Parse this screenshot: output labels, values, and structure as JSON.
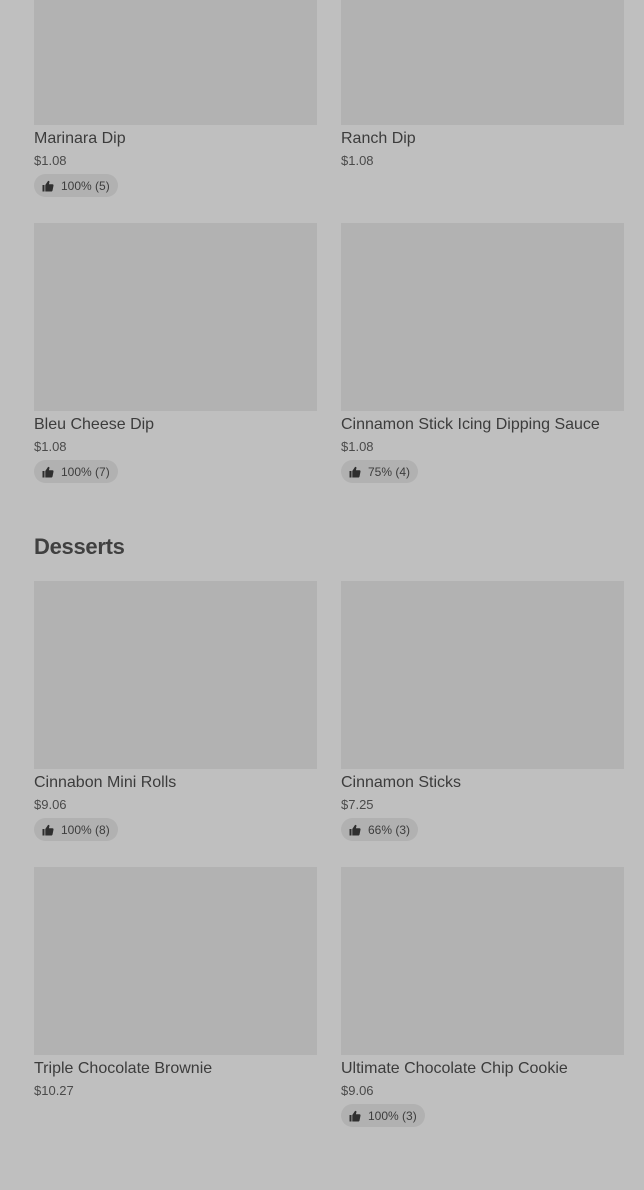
{
  "top_items": [
    {
      "name": "Marinara Dip",
      "price": "$1.08",
      "rating": "100% (5)"
    },
    {
      "name": "Ranch Dip",
      "price": "$1.08",
      "rating": ""
    },
    {
      "name": "Bleu Cheese Dip",
      "price": "$1.08",
      "rating": "100% (7)"
    },
    {
      "name": "Cinnamon Stick Icing Dipping Sauce",
      "price": "$1.08",
      "rating": "75% (4)"
    }
  ],
  "desserts": {
    "title": "Desserts",
    "items": [
      {
        "name": "Cinnabon Mini Rolls",
        "price": "$9.06",
        "rating": "100% (8)"
      },
      {
        "name": "Cinnamon Sticks",
        "price": "$7.25",
        "rating": "66% (3)"
      },
      {
        "name": "Triple Chocolate Brownie",
        "price": "$10.27",
        "rating": ""
      },
      {
        "name": "Ultimate Chocolate Chip Cookie",
        "price": "$9.06",
        "rating": "100% (3)"
      }
    ]
  },
  "icons": {
    "rating": "thumbs-up-icon"
  },
  "colors": {
    "background": "#bfbfbf",
    "image_placeholder": "#b2b2b2",
    "rating_pill": "#b1b1b1",
    "text": "#3c3c3c"
  }
}
